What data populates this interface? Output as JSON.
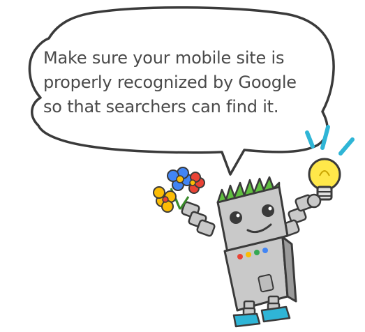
{
  "bubble": {
    "lines": [
      "Make sure your mobile site is",
      "properly recognized by Google",
      "so that searchers can find it."
    ]
  },
  "colors": {
    "outline": "#3a3a3a",
    "bubble_fill": "#ffffff",
    "robot_body": "#c9c9c9",
    "robot_shadow": "#9a9a9a",
    "hair": "#5fbf3f",
    "bulb": "#ffe84a",
    "rays": "#2fb5d6",
    "shoes": "#2fb5d6",
    "led_red": "#ea4335",
    "led_yellow": "#fbbc05",
    "led_green": "#34a853",
    "led_blue": "#4285f4"
  }
}
